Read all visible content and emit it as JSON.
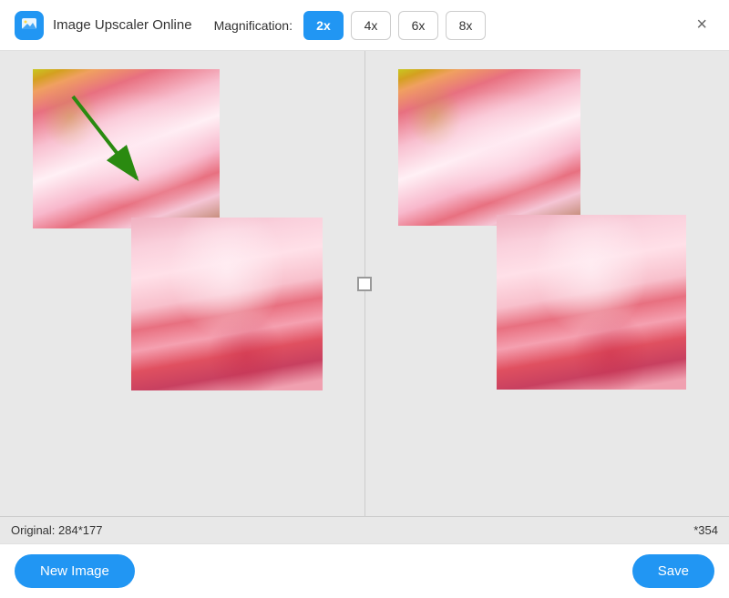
{
  "header": {
    "app_title": "Image Upscaler Online",
    "magnification_label": "Magnification:",
    "close_icon": "×",
    "mag_buttons": [
      {
        "label": "2x",
        "active": true
      },
      {
        "label": "4x",
        "active": false
      },
      {
        "label": "6x",
        "active": false
      },
      {
        "label": "8x",
        "active": false
      }
    ]
  },
  "status": {
    "original_size": "Original: 284*177",
    "upscaled_size": "*354"
  },
  "footer": {
    "new_image_label": "New Image",
    "save_label": "Save"
  },
  "divider": {
    "checkbox_label": ""
  }
}
